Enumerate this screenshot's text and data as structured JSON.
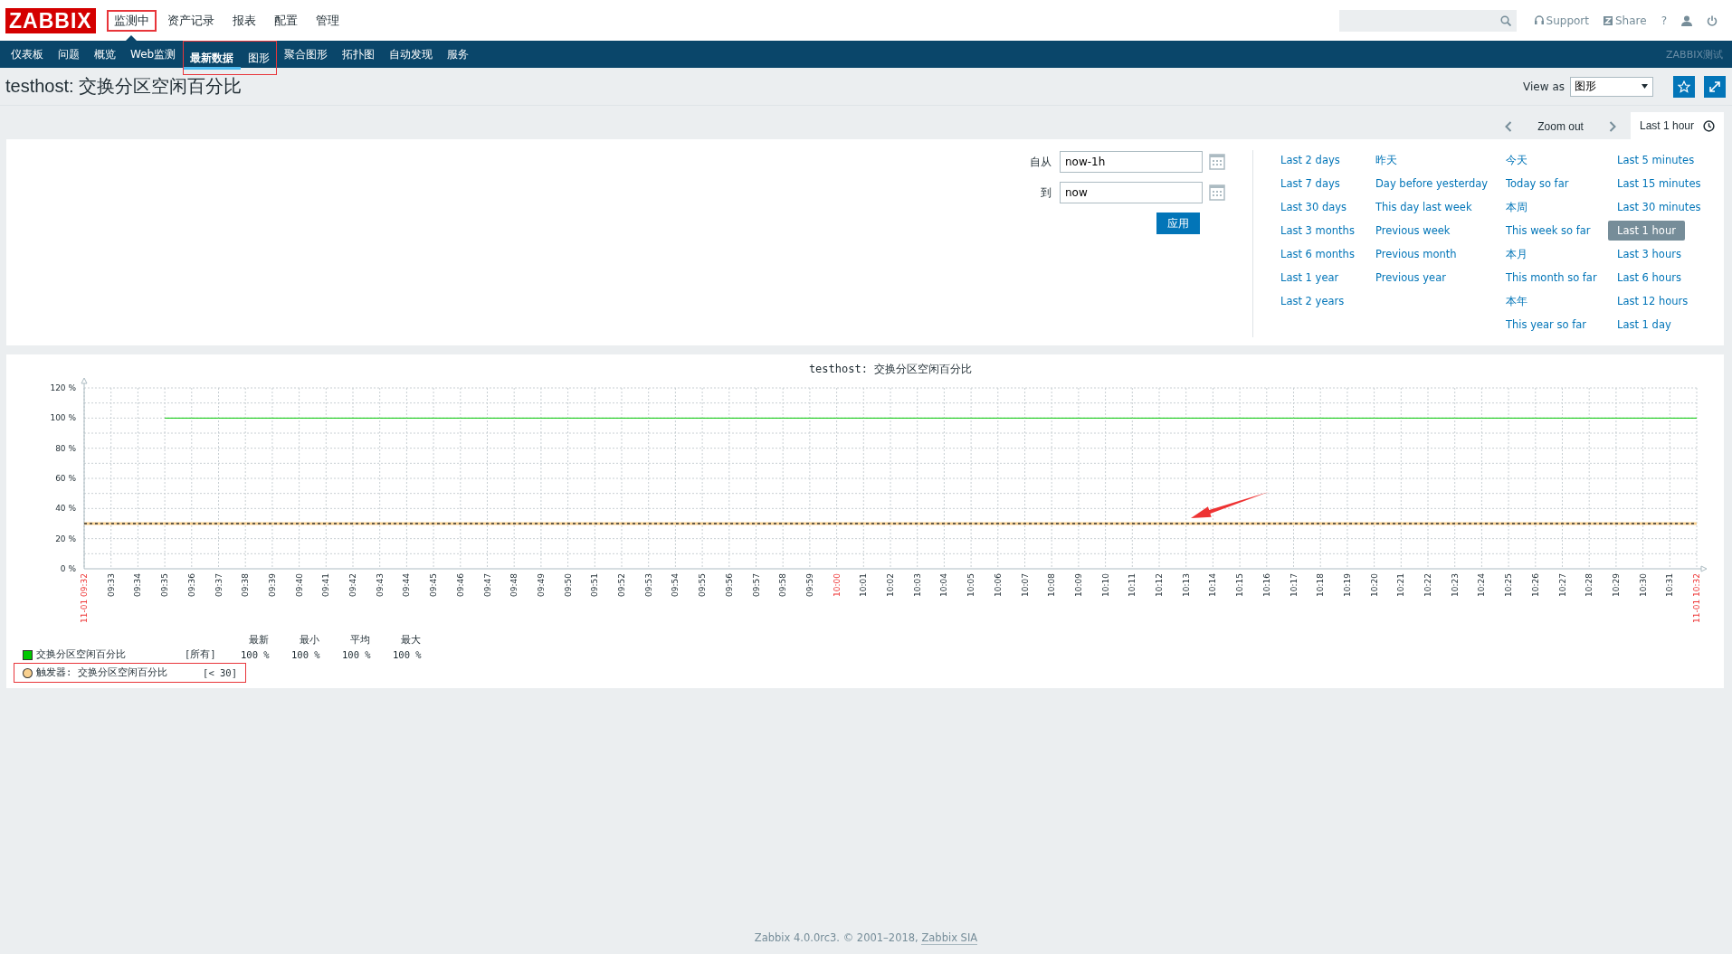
{
  "header": {
    "logo": "ZABBIX",
    "menu": [
      {
        "label": "监测中",
        "selected": true,
        "highlighted": true
      },
      {
        "label": "资产记录",
        "selected": false,
        "highlighted": false
      },
      {
        "label": "报表",
        "selected": false,
        "highlighted": false
      },
      {
        "label": "配置",
        "selected": false,
        "highlighted": false
      },
      {
        "label": "管理",
        "selected": false,
        "highlighted": false
      }
    ],
    "links": [
      {
        "label": "Support",
        "kind": "support"
      },
      {
        "label": "Share",
        "kind": "share"
      },
      {
        "label": "?",
        "kind": "help"
      }
    ]
  },
  "subnav": {
    "items": [
      {
        "label": "仪表板",
        "selected": false,
        "highlighted": false
      },
      {
        "label": "问题",
        "selected": false,
        "highlighted": false
      },
      {
        "label": "概览",
        "selected": false,
        "highlighted": false
      },
      {
        "label": "Web监测",
        "selected": false,
        "highlighted": false
      },
      {
        "label": "最新数据",
        "selected": true,
        "highlighted": true
      },
      {
        "label": "图形",
        "selected": false,
        "highlighted": true
      },
      {
        "label": "聚合图形",
        "selected": false,
        "highlighted": false
      },
      {
        "label": "拓扑图",
        "selected": false,
        "highlighted": false
      },
      {
        "label": "自动发现",
        "selected": false,
        "highlighted": false
      },
      {
        "label": "服务",
        "selected": false,
        "highlighted": false
      }
    ],
    "brand": "ZABBIX测试"
  },
  "page": {
    "title": "testhost: 交换分区空闲百分比",
    "view_as_label": "View as",
    "view_as_value": "图形"
  },
  "time_tabs": {
    "zoom_out": "Zoom out",
    "active_tab": "Last 1 hour"
  },
  "filter": {
    "from_label": "自从",
    "from_value": "now-1h",
    "to_label": "到",
    "to_value": "now",
    "apply": "应用",
    "quick_ranges": [
      [
        {
          "label": "Last 2 days",
          "selected": false
        },
        {
          "label": "Last 7 days",
          "selected": false
        },
        {
          "label": "Last 30 days",
          "selected": false
        },
        {
          "label": "Last 3 months",
          "selected": false
        },
        {
          "label": "Last 6 months",
          "selected": false
        },
        {
          "label": "Last 1 year",
          "selected": false
        },
        {
          "label": "Last 2 years",
          "selected": false
        }
      ],
      [
        {
          "label": "昨天",
          "selected": false
        },
        {
          "label": "Day before yesterday",
          "selected": false
        },
        {
          "label": "This day last week",
          "selected": false
        },
        {
          "label": "Previous week",
          "selected": false
        },
        {
          "label": "Previous month",
          "selected": false
        },
        {
          "label": "Previous year",
          "selected": false
        }
      ],
      [
        {
          "label": "今天",
          "selected": false
        },
        {
          "label": "Today so far",
          "selected": false
        },
        {
          "label": "本周",
          "selected": false
        },
        {
          "label": "This week so far",
          "selected": false
        },
        {
          "label": "本月",
          "selected": false
        },
        {
          "label": "This month so far",
          "selected": false
        },
        {
          "label": "本年",
          "selected": false
        },
        {
          "label": "This year so far",
          "selected": false
        }
      ],
      [
        {
          "label": "Last 5 minutes",
          "selected": false
        },
        {
          "label": "Last 15 minutes",
          "selected": false
        },
        {
          "label": "Last 30 minutes",
          "selected": false
        },
        {
          "label": "Last 1 hour",
          "selected": true
        },
        {
          "label": "Last 3 hours",
          "selected": false
        },
        {
          "label": "Last 6 hours",
          "selected": false
        },
        {
          "label": "Last 12 hours",
          "selected": false
        },
        {
          "label": "Last 1 day",
          "selected": false
        }
      ]
    ]
  },
  "graph": {
    "marker_arrow": true,
    "chart_data": {
      "type": "line",
      "title": "testhost: 交换分区空闲百分比",
      "ylim": [
        0,
        120
      ],
      "grid": true,
      "yticks": [
        {
          "value": 0,
          "label": "0 %"
        },
        {
          "value": 20,
          "label": "20 %"
        },
        {
          "value": 40,
          "label": "40 %"
        },
        {
          "value": 60,
          "label": "60 %"
        },
        {
          "value": 80,
          "label": "80 %"
        },
        {
          "value": 100,
          "label": "100 %"
        },
        {
          "value": 120,
          "label": "120 %"
        }
      ],
      "categories": [
        "11-01 09:32",
        "09:33",
        "09:34",
        "09:35",
        "09:36",
        "09:37",
        "09:38",
        "09:39",
        "09:40",
        "09:41",
        "09:42",
        "09:43",
        "09:44",
        "09:45",
        "09:46",
        "09:47",
        "09:48",
        "09:49",
        "09:50",
        "09:51",
        "09:52",
        "09:53",
        "09:54",
        "09:55",
        "09:56",
        "09:57",
        "09:58",
        "09:59",
        "10:00",
        "10:01",
        "10:02",
        "10:03",
        "10:04",
        "10:05",
        "10:06",
        "10:07",
        "10:08",
        "10:09",
        "10:10",
        "10:11",
        "10:12",
        "10:13",
        "10:14",
        "10:15",
        "10:16",
        "10:17",
        "10:18",
        "10:19",
        "10:20",
        "10:21",
        "10:22",
        "10:23",
        "10:24",
        "10:25",
        "10:26",
        "10:27",
        "10:28",
        "10:29",
        "10:30",
        "10:31",
        "11-01 10:32"
      ],
      "series": [
        {
          "name": "交换分区空闲百分比",
          "color": "#00c800",
          "values": [
            null,
            null,
            null,
            100,
            100,
            100,
            100,
            100,
            100,
            100,
            100,
            100,
            100,
            100,
            100,
            100,
            100,
            100,
            100,
            100,
            100,
            100,
            100,
            100,
            100,
            100,
            100,
            100,
            100,
            100,
            100,
            100,
            100,
            100,
            100,
            100,
            100,
            100,
            100,
            100,
            100,
            100,
            100,
            100,
            100,
            100,
            100,
            100,
            100,
            100,
            100,
            100,
            100,
            100,
            100,
            100,
            100,
            100,
            100,
            100,
            100
          ]
        },
        {
          "name": "触发器: 交换分区空闲百分比",
          "color": "#f8d08f",
          "values": [
            30,
            30,
            30,
            30,
            30,
            30,
            30,
            30,
            30,
            30,
            30,
            30,
            30,
            30,
            30,
            30,
            30,
            30,
            30,
            30,
            30,
            30,
            30,
            30,
            30,
            30,
            30,
            30,
            30,
            30,
            30,
            30,
            30,
            30,
            30,
            30,
            30,
            30,
            30,
            30,
            30,
            30,
            30,
            30,
            30,
            30,
            30,
            30,
            30,
            30,
            30,
            30,
            30,
            30,
            30,
            30,
            30,
            30,
            30,
            30,
            30
          ]
        }
      ]
    },
    "x_labels": [
      {
        "highlighted": true
      },
      {
        "highlighted": false
      },
      {
        "highlighted": false
      },
      {
        "highlighted": false
      },
      {
        "highlighted": false
      },
      {
        "highlighted": false
      },
      {
        "highlighted": false
      },
      {
        "highlighted": false
      },
      {
        "highlighted": false
      },
      {
        "highlighted": false
      },
      {
        "highlighted": false
      },
      {
        "highlighted": false
      },
      {
        "highlighted": false
      },
      {
        "highlighted": false
      },
      {
        "highlighted": false
      },
      {
        "highlighted": false
      },
      {
        "highlighted": false
      },
      {
        "highlighted": false
      },
      {
        "highlighted": false
      },
      {
        "highlighted": false
      },
      {
        "highlighted": false
      },
      {
        "highlighted": false
      },
      {
        "highlighted": false
      },
      {
        "highlighted": false
      },
      {
        "highlighted": false
      },
      {
        "highlighted": false
      },
      {
        "highlighted": false
      },
      {
        "highlighted": false
      },
      {
        "highlighted": true
      },
      {
        "highlighted": false
      },
      {
        "highlighted": false
      },
      {
        "highlighted": false
      },
      {
        "highlighted": false
      },
      {
        "highlighted": false
      },
      {
        "highlighted": false
      },
      {
        "highlighted": false
      },
      {
        "highlighted": false
      },
      {
        "highlighted": false
      },
      {
        "highlighted": false
      },
      {
        "highlighted": false
      },
      {
        "highlighted": false
      },
      {
        "highlighted": false
      },
      {
        "highlighted": false
      },
      {
        "highlighted": false
      },
      {
        "highlighted": false
      },
      {
        "highlighted": false
      },
      {
        "highlighted": false
      },
      {
        "highlighted": false
      },
      {
        "highlighted": false
      },
      {
        "highlighted": false
      },
      {
        "highlighted": false
      },
      {
        "highlighted": false
      },
      {
        "highlighted": false
      },
      {
        "highlighted": false
      },
      {
        "highlighted": false
      },
      {
        "highlighted": false
      },
      {
        "highlighted": false
      },
      {
        "highlighted": false
      },
      {
        "highlighted": false
      },
      {
        "highlighted": false
      },
      {
        "highlighted": true
      }
    ],
    "legend": {
      "headers": [
        "最新",
        "最小",
        "平均",
        "最大"
      ],
      "function": "[所有]",
      "values": [
        "100 %",
        "100 %",
        "100 %",
        "100 %"
      ],
      "trigger_condition": "[< 30]",
      "trigger_highlighted": true
    }
  },
  "footer": {
    "text": "Zabbix 4.0.0rc3. © 2001–2018,",
    "link": "Zabbix SIA"
  }
}
